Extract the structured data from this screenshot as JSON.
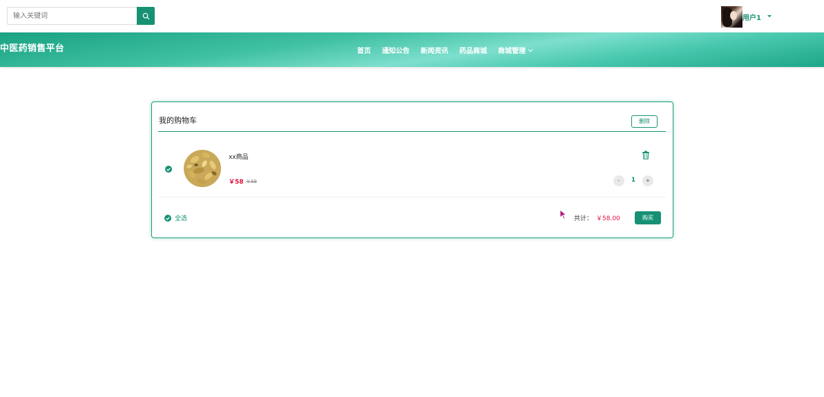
{
  "search": {
    "placeholder": "输入关键词"
  },
  "user": {
    "name": "用户1"
  },
  "site": {
    "title": "中医药销售平台"
  },
  "nav": {
    "items": [
      {
        "label": "首页"
      },
      {
        "label": "通知公告"
      },
      {
        "label": "新闻资讯"
      },
      {
        "label": "药品商城"
      },
      {
        "label": "商城管理"
      }
    ]
  },
  "cart": {
    "title": "我的购物车",
    "delete_label": "删除",
    "items": [
      {
        "name": "xx商品",
        "price": "￥58",
        "old_price": "￥88",
        "quantity": "1"
      }
    ],
    "qty_minus": "-",
    "qty_plus": "+",
    "select_all": "全选",
    "total_label": "共计：",
    "total_value": "￥58.00",
    "buy_label": "购买"
  },
  "colors": {
    "accent": "#169173",
    "price": "#e0103c",
    "nav_gradient_light": "#7ddfcd"
  },
  "icons": {
    "search": "search-icon",
    "trash": "trash-icon",
    "check": "check-circle-icon",
    "caret": "caret-down-icon",
    "chevron": "chevron-down-icon"
  }
}
